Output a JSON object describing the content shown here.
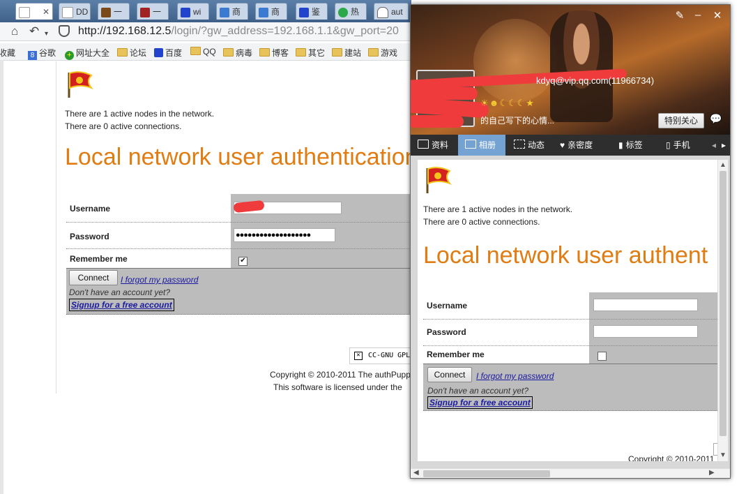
{
  "browser": {
    "tabs": [
      {
        "label": "",
        "icon": "page-icon"
      },
      {
        "label": "DD",
        "icon": "page-icon"
      },
      {
        "label": "一",
        "icon": "book-icon"
      },
      {
        "label": "一",
        "icon": "image-icon"
      },
      {
        "label": "wi",
        "icon": "paw-icon"
      },
      {
        "label": "商",
        "icon": "wifi-icon"
      },
      {
        "label": "商",
        "icon": "wifi-icon"
      },
      {
        "label": "鉴",
        "icon": "paw-icon"
      },
      {
        "label": "热",
        "icon": "refresh-icon"
      },
      {
        "label": "aut",
        "icon": "headphones-icon"
      }
    ],
    "url_host": "http://192.168.12.5",
    "url_rest": "/login/?gw_address=192.168.1.1&gw_port=20",
    "bookmarks": [
      {
        "label": "收藏",
        "icon": "star-icon"
      },
      {
        "label": "谷歌",
        "icon": "google-icon"
      },
      {
        "label": "网址大全",
        "icon": "plus-icon"
      },
      {
        "label": "论坛",
        "icon": "folder-icon"
      },
      {
        "label": "百度",
        "icon": "paw-icon"
      },
      {
        "label": "QQ",
        "icon": "folder-icon"
      },
      {
        "label": "病毒",
        "icon": "folder-icon"
      },
      {
        "label": "博客",
        "icon": "folder-icon"
      },
      {
        "label": "其它",
        "icon": "folder-icon"
      },
      {
        "label": "建站",
        "icon": "folder-icon"
      },
      {
        "label": "游戏",
        "icon": "folder-icon"
      }
    ]
  },
  "portal": {
    "nodes_text": "There are 1 active nodes in the network.",
    "connections_text": "There are 0 active connections.",
    "title": "Local network user authentication",
    "username_label": "Username",
    "password_label": "Password",
    "remember_label": "Remember me",
    "password_value": "●●●●●●●●●●●●●●●●●●●",
    "remember_checked": true,
    "connect_label": "Connect",
    "forgot_label": "I forgot my password",
    "no_account_text": "Don't have an account yet?",
    "signup_label": "Signup for a free account",
    "cc_label": "CC-GNU GPL",
    "copyright": "Copyright © 2010-2011 The authPupp",
    "license": "This software is licensed under the"
  },
  "qq_profile": {
    "email": "kdyq@vip.qq.com(11966734)",
    "levels": "☀☻☾☾☾★",
    "signature": "的自己写下的心情...",
    "special_care_label": "特别关心",
    "tabs": [
      {
        "label": "资料",
        "icon": "card-icon"
      },
      {
        "label": "相册",
        "icon": "album-icon"
      },
      {
        "label": "动态",
        "icon": "list-icon"
      },
      {
        "label": "亲密度",
        "icon": "heart-icon"
      },
      {
        "label": "标签",
        "icon": "bookmark-icon"
      },
      {
        "label": "手机",
        "icon": "phone-icon"
      }
    ],
    "active_tab": "相册",
    "embedded": {
      "nodes_text": "There are 1 active nodes in the network.",
      "connections_text": "There are 0 active connections.",
      "title": "Local network user authent",
      "username_label": "Username",
      "password_label": "Password",
      "remember_label": "Remember me",
      "remember_checked": false,
      "connect_label": "Connect",
      "forgot_label": "I forgot my password",
      "no_account_text": "Don't have an account yet?",
      "signup_label": "Signup for a free account",
      "copyright": "Copyright © 2010-2011"
    }
  },
  "colors": {
    "title_orange": "#e07c12",
    "link_blue": "#1a1aa0",
    "form_gray": "#bcbcbc",
    "qq_tab_active": "#74a3d3",
    "redaction": "#ef3b3b"
  }
}
